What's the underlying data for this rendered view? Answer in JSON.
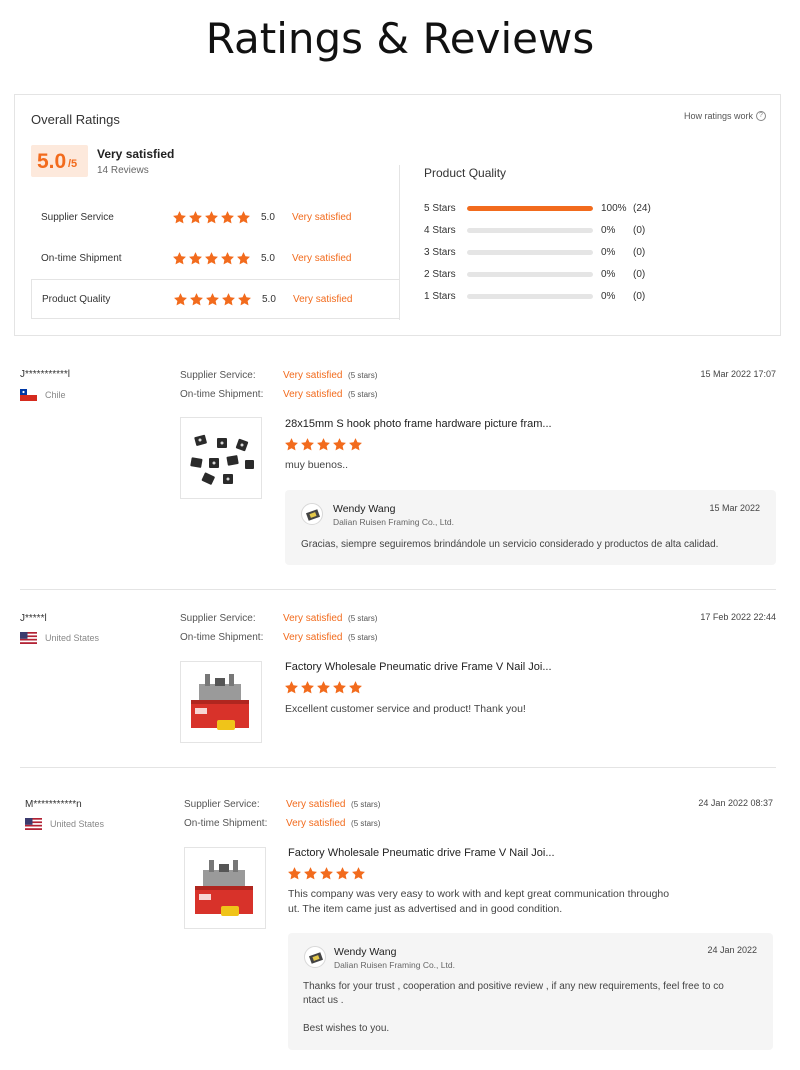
{
  "page_title": "Ratings & Reviews",
  "summary": {
    "overall_label": "Overall Ratings",
    "how_link": "How ratings work",
    "score": "5.0",
    "score_max": "/5",
    "level": "Very satisfied",
    "reviews_count": "14 Reviews",
    "categories": [
      {
        "name": "Supplier Service",
        "score": "5.0",
        "level": "Very satisfied",
        "stars": 5
      },
      {
        "name": "On-time Shipment",
        "score": "5.0",
        "level": "Very satisfied",
        "stars": 5
      },
      {
        "name": "Product Quality",
        "score": "5.0",
        "level": "Very satisfied",
        "stars": 5
      }
    ],
    "product_quality": {
      "title": "Product Quality",
      "distribution": [
        {
          "label": "5 Stars",
          "fraction": 1.0,
          "percent": "100%",
          "count": "(24)"
        },
        {
          "label": "4 Stars",
          "fraction": 0,
          "percent": "0%",
          "count": "(0)"
        },
        {
          "label": "3 Stars",
          "fraction": 0,
          "percent": "0%",
          "count": "(0)"
        },
        {
          "label": "2 Stars",
          "fraction": 0,
          "percent": "0%",
          "count": "(0)"
        },
        {
          "label": "1 Stars",
          "fraction": 0,
          "percent": "0%",
          "count": "(0)"
        }
      ]
    }
  },
  "reviews": [
    {
      "user": "J***********l",
      "country": "Chile",
      "flag": "chile-flag",
      "date": "15 Mar 2022 17:07",
      "supplier_service_label": "Supplier Service:",
      "supplier_service_value": "Very satisfied",
      "supplier_service_stars": "(5 stars)",
      "shipment_label": "On-time Shipment:",
      "shipment_value": "Very satisfied",
      "shipment_stars": "(5 stars)",
      "product_title": "28x15mm S hook photo frame hardware picture fram...",
      "rating": 5,
      "comment": "muy buenos..",
      "reply": {
        "name": "Wendy Wang",
        "company": "Dalian Ruisen Framing Co., Ltd.",
        "date": "15 Mar 2022",
        "text": "Gracias, siempre seguiremos brindándole un servicio considerado y productos de alta calidad."
      }
    },
    {
      "user": "J*****l",
      "country": "United States",
      "flag": "us-flag",
      "date": "17 Feb 2022 22:44",
      "supplier_service_label": "Supplier Service:",
      "supplier_service_value": "Very satisfied",
      "supplier_service_stars": "(5 stars)",
      "shipment_label": "On-time Shipment:",
      "shipment_value": "Very satisfied",
      "shipment_stars": "(5 stars)",
      "product_title": "Factory Wholesale Pneumatic drive Frame V Nail Joi...",
      "rating": 5,
      "comment": "Excellent customer service and product! Thank you!"
    },
    {
      "user": "M***********n",
      "country": "United States",
      "flag": "us-flag",
      "date": "24 Jan 2022 08:37",
      "supplier_service_label": "Supplier Service:",
      "supplier_service_value": "Very satisfied",
      "supplier_service_stars": "(5 stars)",
      "shipment_label": "On-time Shipment:",
      "shipment_value": "Very satisfied",
      "shipment_stars": "(5 stars)",
      "product_title": "Factory Wholesale Pneumatic drive Frame V Nail Joi...",
      "rating": 5,
      "comment_line1": "This company was very easy to work with and kept great communication througho",
      "comment_line2": "ut. The item came just as advertised and in good condition.",
      "reply": {
        "name": "Wendy Wang",
        "company": "Dalian Ruisen Framing Co., Ltd.",
        "date": "24 Jan 2022",
        "text_line1": "Thanks for your trust , cooperation and positive review , if any new requirements, feel free  to co",
        "text_line2": "ntact us .",
        "text_line3": "Best wishes to you."
      }
    }
  ],
  "colors": {
    "accent": "#f26b1d",
    "badge_bg": "#fde9dc",
    "reply_bg": "#f5f5f5",
    "divider": "#e4e4e4"
  }
}
